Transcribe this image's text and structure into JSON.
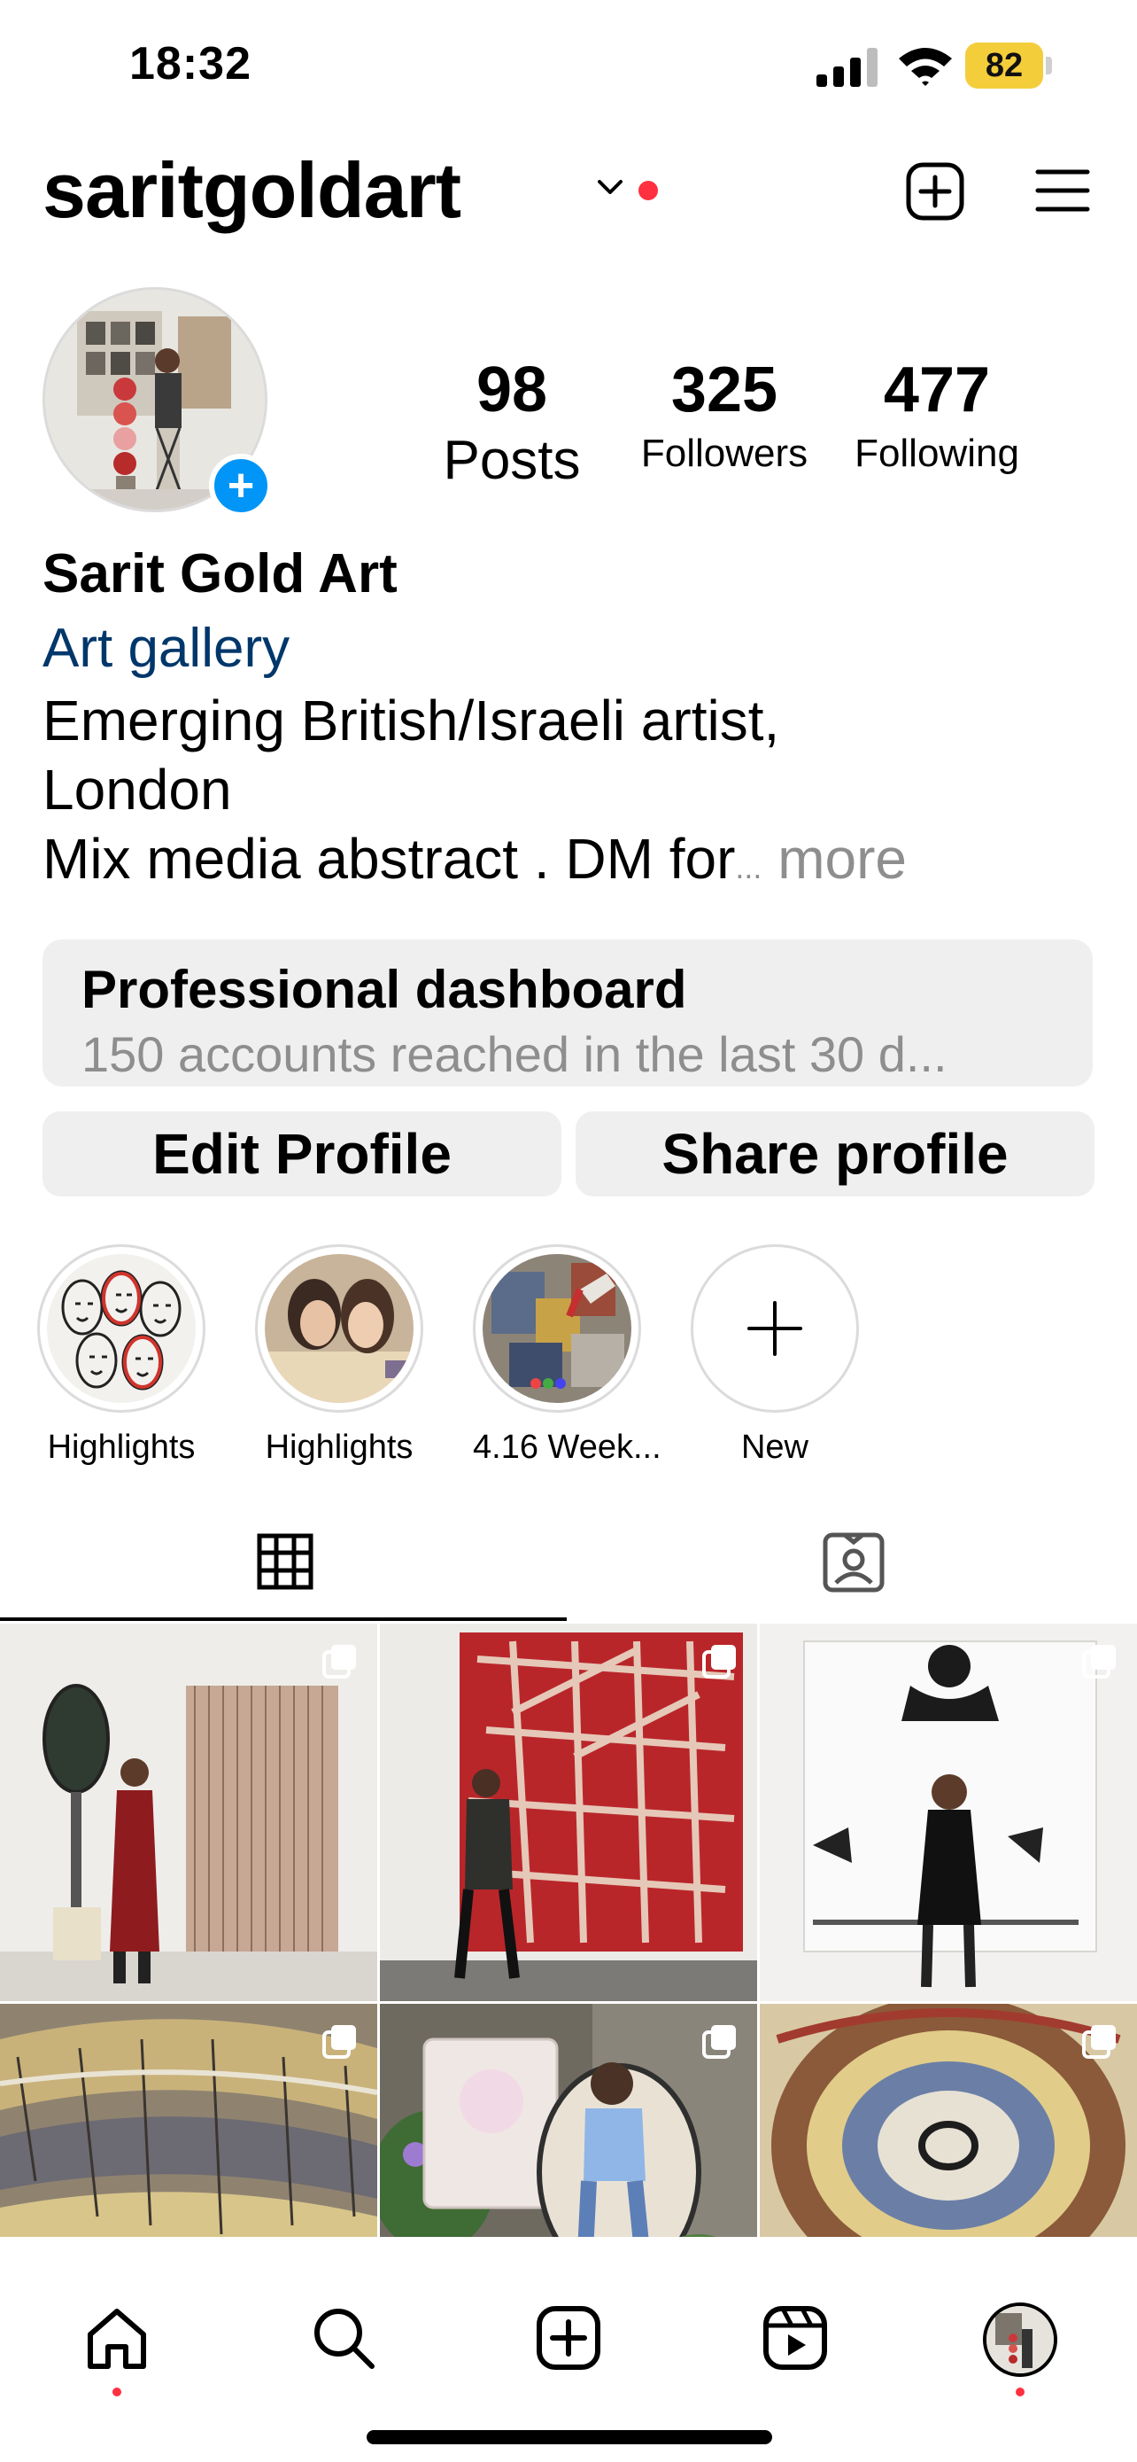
{
  "status_bar": {
    "time": "18:32",
    "battery": "82"
  },
  "header": {
    "username": "saritgoldart"
  },
  "profile": {
    "stats": {
      "posts": {
        "count": "98",
        "label": "Posts"
      },
      "followers": {
        "count": "325",
        "label": "Followers"
      },
      "following": {
        "count": "477",
        "label": "Following"
      }
    },
    "name": "Sarit Gold Art",
    "category": "Art gallery",
    "bio_line1": "Emerging British/Israeli artist,",
    "bio_line2": "London",
    "bio_line3": "Mix media abstract . DM for",
    "bio_ellipsis": "...",
    "bio_more": " more"
  },
  "dashboard": {
    "title": "Professional dashboard",
    "subtitle": "150 accounts reached in the last 30 d..."
  },
  "buttons": {
    "edit_profile": "Edit Profile",
    "share_profile": "Share profile"
  },
  "highlights": [
    {
      "label": "Highlights"
    },
    {
      "label": "Highlights"
    },
    {
      "label": "4.16 Week..."
    },
    {
      "label": "New"
    }
  ],
  "tabs": {
    "icons": [
      "grid-icon",
      "tagged-icon"
    ]
  },
  "nav": {
    "icons": [
      "home-icon",
      "search-icon",
      "create-icon",
      "reels-icon",
      "profile-avatar"
    ]
  },
  "colors": {
    "link": "#00376b",
    "notification": "#ff3040",
    "accent": "#0095f6",
    "battery": "#f4cd3b"
  }
}
